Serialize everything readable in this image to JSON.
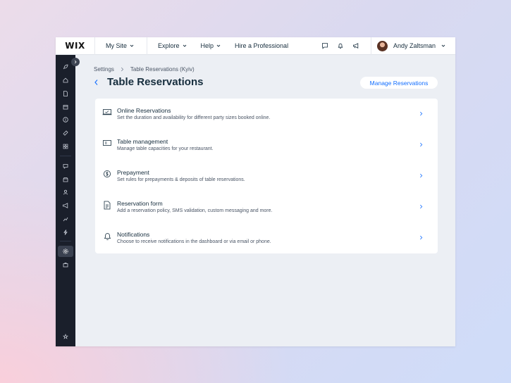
{
  "topbar": {
    "logo": "WIX",
    "my_site": "My Site",
    "explore": "Explore",
    "help": "Help",
    "hire": "Hire a Professional",
    "user_name": "Andy Zaltsman",
    "icons": [
      "chat-icon",
      "bell-icon",
      "megaphone-icon"
    ]
  },
  "sidebar": {
    "icons": [
      "rocket-icon",
      "home-icon",
      "document-icon",
      "calendar-icon",
      "dollar-icon",
      "paint-icon",
      "apps-icon",
      "inbox-icon",
      "store-icon",
      "contacts-icon",
      "megaphone-icon",
      "analytics-icon",
      "automation-icon",
      "settings-icon",
      "toolbox-icon",
      "quick-access-icon"
    ],
    "active": "settings-icon"
  },
  "breadcrumb": {
    "root": "Settings",
    "current": "Table Reservations (Kyiv)"
  },
  "page": {
    "title": "Table Reservations",
    "manage_button": "Manage Reservations"
  },
  "settings_list": [
    {
      "icon": "laptop-icon",
      "title": "Online Reservations",
      "description": "Set the duration and availability for different party sizes booked online."
    },
    {
      "icon": "table-icon",
      "title": "Table management",
      "description": "Manage table capacities for your restaurant."
    },
    {
      "icon": "coin-icon",
      "title": "Prepayment",
      "description": "Set rules for prepayments & deposits of table reservations."
    },
    {
      "icon": "form-icon",
      "title": "Reservation form",
      "description": "Add a reservation policy, SMS validation, custom messaging and more."
    },
    {
      "icon": "bell-icon",
      "title": "Notifications",
      "description": "Choose to receive notifications in the dashboard or via email or phone."
    }
  ],
  "colors": {
    "accent": "#116dff",
    "sidebar_bg": "#1a1f2b",
    "content_bg": "#eceff4",
    "text": "#162d3d"
  }
}
